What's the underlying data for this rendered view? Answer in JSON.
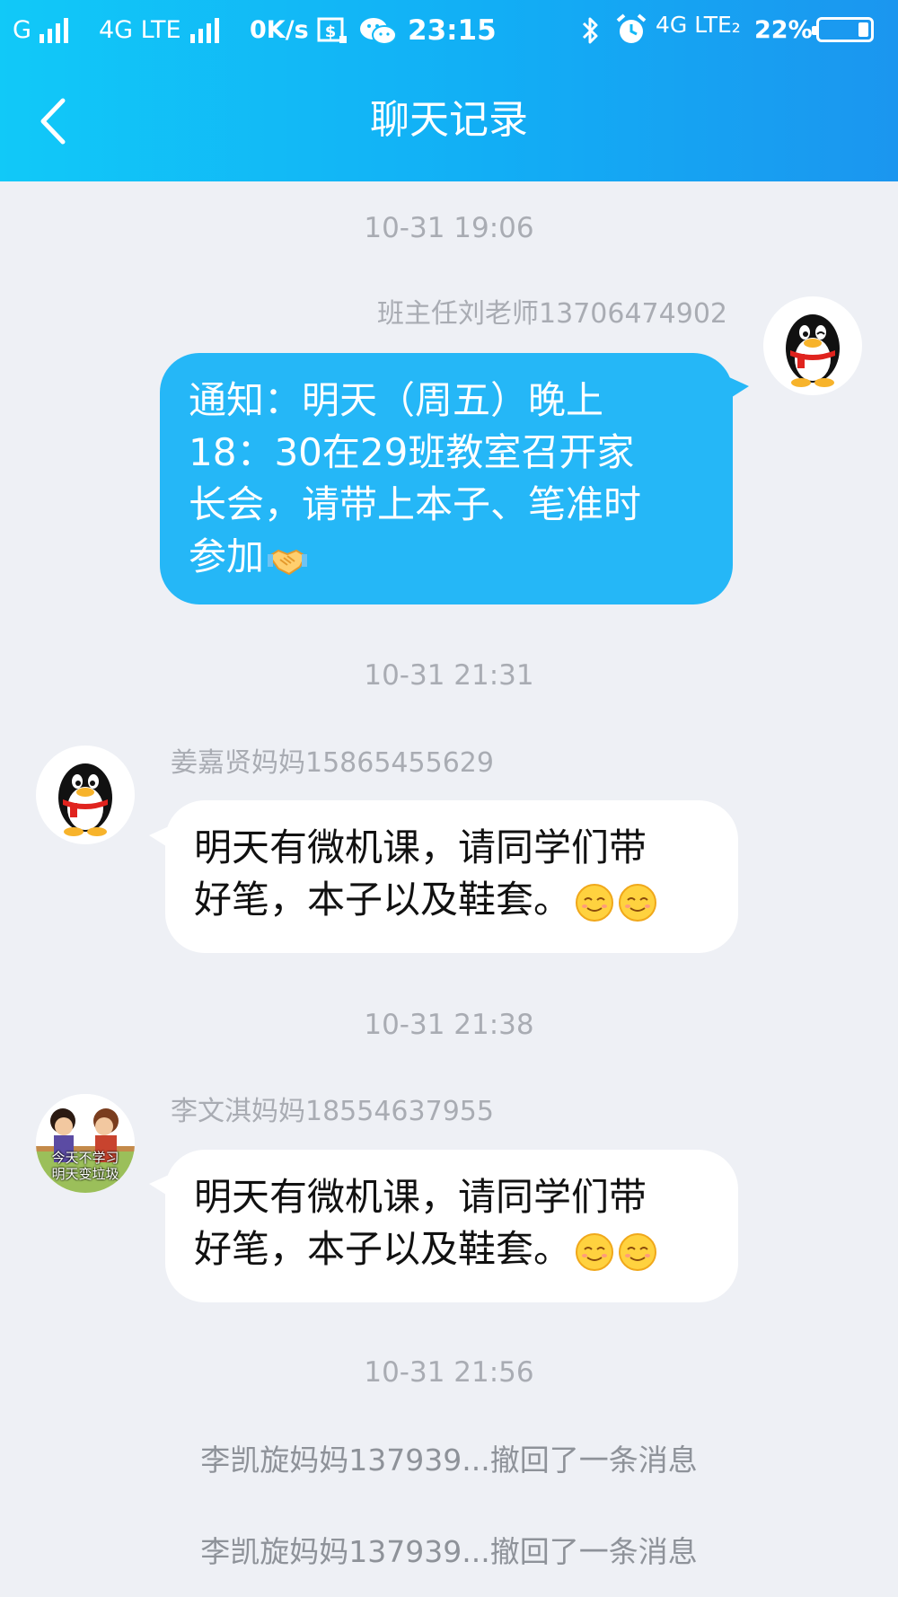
{
  "status_bar": {
    "carrier1": "G",
    "carrier2": "4G LTE",
    "speed": "0K/s",
    "time": "23:15",
    "network": "4G LTE₂",
    "battery": "22%",
    "icons": [
      "signal-icon",
      "data-saver-icon",
      "wechat-icon",
      "bluetooth-icon",
      "alarm-icon",
      "battery-icon"
    ]
  },
  "nav": {
    "back_icon": "chevron-left-icon",
    "title": "聊天记录"
  },
  "colors": {
    "header_start": "#11c9f8",
    "header_end": "#1b96ef",
    "bubble_blue": "#25b7f7",
    "background": "#eef0f5"
  },
  "messages": [
    {
      "timestamp": "10-31 19:06",
      "sender": "班主任刘老师13706474902",
      "side": "right",
      "avatar": "qq-penguin-avatar",
      "text": "通知：明天（周五）晚上\n18：30在29班教室召开家\n长会，请带上本子、笔准时\n参加",
      "emoji": [
        "handshake-emoji"
      ]
    },
    {
      "timestamp": "10-31 21:31",
      "sender": "姜嘉贤妈妈15865455629",
      "side": "left",
      "avatar": "qq-penguin-avatar",
      "text": "明天有微机课，请同学们带\n好笔，本子以及鞋套。",
      "emoji": [
        "smile-emoji",
        "smile-emoji"
      ]
    },
    {
      "timestamp": "10-31 21:38",
      "sender": "李文淇妈妈18554637955",
      "side": "left",
      "avatar": "cartoon-photo-avatar",
      "avatar_caption": "今天不学习\n明天变垃圾",
      "text": "明天有微机课，请同学们带\n好笔，本子以及鞋套。",
      "emoji": [
        "smile-emoji",
        "smile-emoji"
      ]
    }
  ],
  "recall_timestamp": "10-31 21:56",
  "recall_notices": [
    "李凯旋妈妈137939...撤回了一条消息",
    "李凯旋妈妈137939...撤回了一条消息"
  ]
}
